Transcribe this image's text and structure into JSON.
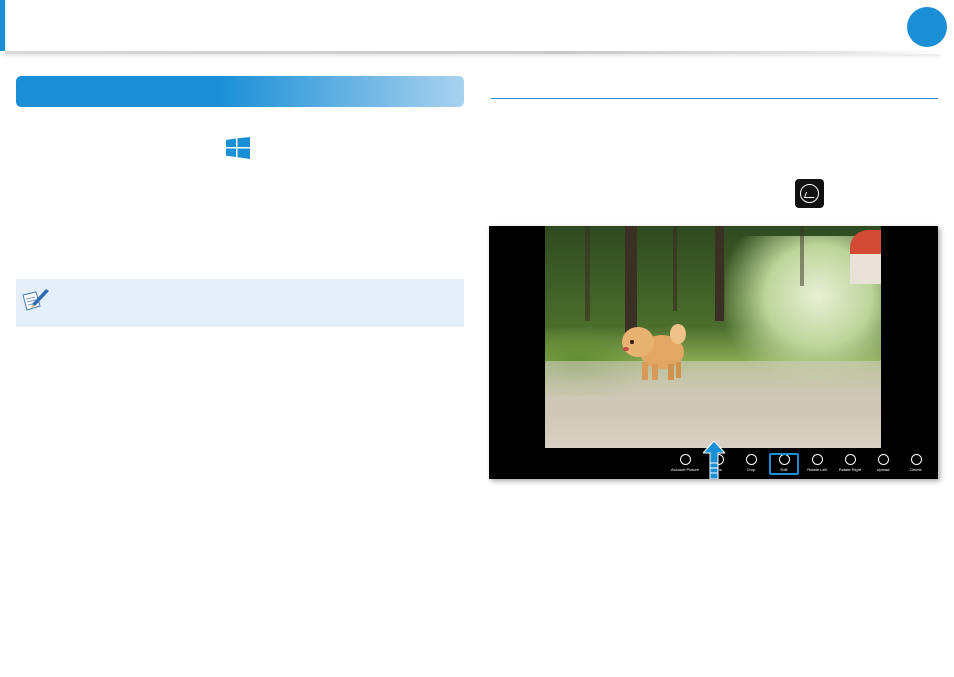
{
  "colors": {
    "accent": "#1a8fd6",
    "note_bg": "#e4eff9",
    "banner_end": "#a9d2ef"
  },
  "icons": {
    "windows_logo": "windows-logo-icon",
    "note": "note-pencil-icon",
    "edit": "edit-photo-icon"
  },
  "screenshot": {
    "toolbar": [
      {
        "label": "Account Picture",
        "icon": "account-picture-icon"
      },
      {
        "label": "...ns",
        "icon": "options-icon"
      },
      {
        "label": "Crop",
        "icon": "crop-icon"
      },
      {
        "label": "Edit",
        "icon": "edit-icon"
      },
      {
        "label": "Rotate Left",
        "icon": "rotate-left-icon"
      },
      {
        "label": "Rotate Right",
        "icon": "rotate-right-icon"
      },
      {
        "label": "Upload",
        "icon": "upload-icon"
      },
      {
        "label": "Delete",
        "icon": "delete-icon"
      }
    ]
  }
}
